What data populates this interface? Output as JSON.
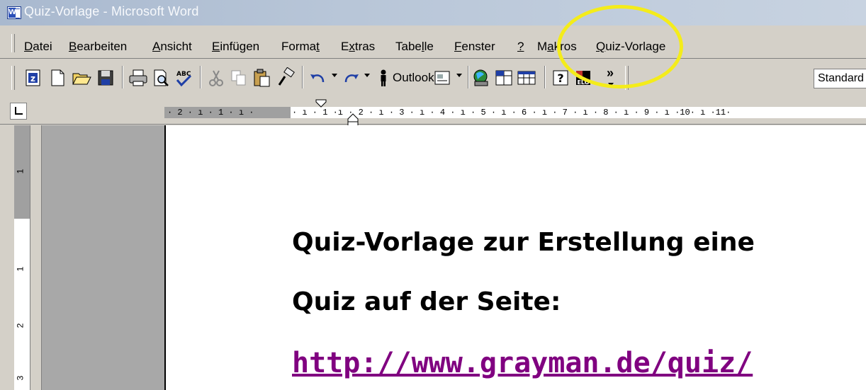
{
  "window": {
    "title": "Quiz-Vorlage - Microsoft Word"
  },
  "menubar": {
    "items": [
      {
        "pre": "",
        "u": "D",
        "post": "atei"
      },
      {
        "pre": "",
        "u": "B",
        "post": "earbeiten"
      },
      {
        "pre": "",
        "u": "A",
        "post": "nsicht"
      },
      {
        "pre": "",
        "u": "E",
        "post": "infügen"
      },
      {
        "pre": "Forma",
        "u": "t",
        "post": ""
      },
      {
        "pre": "E",
        "u": "x",
        "post": "tras"
      },
      {
        "pre": "Tabe",
        "u": "l",
        "post": "le"
      },
      {
        "pre": "",
        "u": "F",
        "post": "enster"
      },
      {
        "pre": "",
        "u": "?",
        "post": ""
      },
      {
        "pre": "M",
        "u": "a",
        "post": "kros"
      },
      {
        "pre": "",
        "u": "Q",
        "post": "uiz-Vorlage"
      }
    ]
  },
  "toolbar": {
    "outlook_label": "Outlook",
    "style_value": "Standard",
    "chevron": "»",
    "icons": [
      "z-icon",
      "new-document-icon",
      "open-folder-icon",
      "save-icon",
      "print-icon",
      "print-preview-icon",
      "spelling-icon",
      "cut-icon",
      "copy-icon",
      "paste-icon",
      "format-painter-icon",
      "undo-icon",
      "redo-icon",
      "outlook-icon",
      "insert-icon",
      "web-icon",
      "table-icon",
      "grid-icon",
      "help-icon",
      "elo-icon"
    ]
  },
  "ruler": {
    "left_numbers": "· 2 · ı · 1 · ı ·",
    "right_numbers": "· ı · 1 ·ı · 2 · ı · 3 · ı · 4 · ı · 5 · ı · 6 · ı · 7 · ı · 8 · ı · 9 · ı ·10· ı ·11·",
    "vertical": [
      "1",
      "1",
      "2",
      "3"
    ]
  },
  "document": {
    "line1": "Quiz-Vorlage zur Erstellung eine",
    "line2": "Quiz auf der Seite:",
    "link": "http://www.grayman.de/quiz/"
  }
}
